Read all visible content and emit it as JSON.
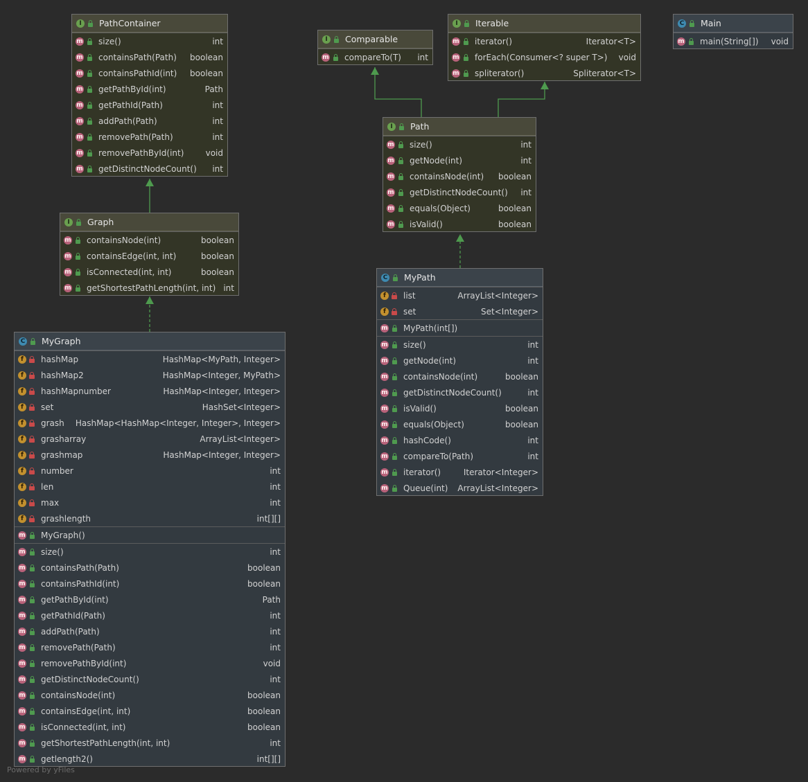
{
  "diagram": {
    "nodes": [
      {
        "id": "PathContainer",
        "kind": "interface",
        "name": "PathContainer",
        "sections": [
          [
            {
              "kind": "m",
              "vis": "public",
              "name": "size()",
              "type": "int"
            },
            {
              "kind": "m",
              "vis": "public",
              "name": "containsPath(Path)",
              "type": "boolean"
            },
            {
              "kind": "m",
              "vis": "public",
              "name": "containsPathId(int)",
              "type": "boolean"
            },
            {
              "kind": "m",
              "vis": "public",
              "name": "getPathById(int)",
              "type": "Path"
            },
            {
              "kind": "m",
              "vis": "public",
              "name": "getPathId(Path)",
              "type": "int"
            },
            {
              "kind": "m",
              "vis": "public",
              "name": "addPath(Path)",
              "type": "int"
            },
            {
              "kind": "m",
              "vis": "public",
              "name": "removePath(Path)",
              "type": "int"
            },
            {
              "kind": "m",
              "vis": "public",
              "name": "removePathById(int)",
              "type": "void"
            },
            {
              "kind": "m",
              "vis": "public",
              "name": "getDistinctNodeCount()",
              "type": "int"
            }
          ]
        ]
      },
      {
        "id": "Comparable",
        "kind": "interface",
        "name": "Comparable",
        "sections": [
          [
            {
              "kind": "m",
              "vis": "public",
              "name": "compareTo(T)",
              "type": "int"
            }
          ]
        ]
      },
      {
        "id": "Iterable",
        "kind": "interface",
        "name": "Iterable",
        "sections": [
          [
            {
              "kind": "m",
              "vis": "public",
              "name": "iterator()",
              "type": "Iterator<T>"
            },
            {
              "kind": "m",
              "vis": "public",
              "name": "forEach(Consumer<? super T>)",
              "type": "void"
            },
            {
              "kind": "m",
              "vis": "public",
              "name": "spliterator()",
              "type": "Spliterator<T>"
            }
          ]
        ]
      },
      {
        "id": "Main",
        "kind": "class",
        "name": "Main",
        "sections": [
          [
            {
              "kind": "m",
              "vis": "public",
              "name": "main(String[])",
              "type": "void"
            }
          ]
        ]
      },
      {
        "id": "Path",
        "kind": "interface",
        "name": "Path",
        "sections": [
          [
            {
              "kind": "m",
              "vis": "public",
              "name": "size()",
              "type": "int"
            },
            {
              "kind": "m",
              "vis": "public",
              "name": "getNode(int)",
              "type": "int"
            },
            {
              "kind": "m",
              "vis": "public",
              "name": "containsNode(int)",
              "type": "boolean"
            },
            {
              "kind": "m",
              "vis": "public",
              "name": "getDistinctNodeCount()",
              "type": "int"
            },
            {
              "kind": "m",
              "vis": "public",
              "name": "equals(Object)",
              "type": "boolean"
            },
            {
              "kind": "m",
              "vis": "public",
              "name": "isValid()",
              "type": "boolean"
            }
          ]
        ]
      },
      {
        "id": "Graph",
        "kind": "interface",
        "name": "Graph",
        "sections": [
          [
            {
              "kind": "m",
              "vis": "public",
              "name": "containsNode(int)",
              "type": "boolean"
            },
            {
              "kind": "m",
              "vis": "public",
              "name": "containsEdge(int, int)",
              "type": "boolean"
            },
            {
              "kind": "m",
              "vis": "public",
              "name": "isConnected(int, int)",
              "type": "boolean"
            },
            {
              "kind": "m",
              "vis": "public",
              "name": "getShortestPathLength(int, int)",
              "type": "int"
            }
          ]
        ]
      },
      {
        "id": "MyPath",
        "kind": "class",
        "name": "MyPath",
        "sections": [
          [
            {
              "kind": "f",
              "vis": "private",
              "name": "list",
              "type": "ArrayList<Integer>"
            },
            {
              "kind": "f",
              "vis": "private",
              "name": "set",
              "type": "Set<Integer>"
            }
          ],
          [
            {
              "kind": "m",
              "vis": "public",
              "name": "MyPath(int[])",
              "type": ""
            }
          ],
          [
            {
              "kind": "m",
              "vis": "public",
              "name": "size()",
              "type": "int"
            },
            {
              "kind": "m",
              "vis": "public",
              "name": "getNode(int)",
              "type": "int"
            },
            {
              "kind": "m",
              "vis": "public",
              "name": "containsNode(int)",
              "type": "boolean"
            },
            {
              "kind": "m",
              "vis": "public",
              "name": "getDistinctNodeCount()",
              "type": "int"
            },
            {
              "kind": "m",
              "vis": "public",
              "name": "isValid()",
              "type": "boolean"
            },
            {
              "kind": "m",
              "vis": "public",
              "name": "equals(Object)",
              "type": "boolean"
            },
            {
              "kind": "m",
              "vis": "public",
              "name": "hashCode()",
              "type": "int"
            },
            {
              "kind": "m",
              "vis": "public",
              "name": "compareTo(Path)",
              "type": "int"
            },
            {
              "kind": "m",
              "vis": "public",
              "name": "iterator()",
              "type": "Iterator<Integer>"
            },
            {
              "kind": "m",
              "vis": "public",
              "name": "Queue(int)",
              "type": "ArrayList<Integer>"
            }
          ]
        ]
      },
      {
        "id": "MyGraph",
        "kind": "class",
        "name": "MyGraph",
        "sections": [
          [
            {
              "kind": "f",
              "vis": "private",
              "name": "hashMap",
              "type": "HashMap<MyPath, Integer>"
            },
            {
              "kind": "f",
              "vis": "private",
              "name": "hashMap2",
              "type": "HashMap<Integer, MyPath>"
            },
            {
              "kind": "f",
              "vis": "private",
              "name": "hashMapnumber",
              "type": "HashMap<Integer, Integer>"
            },
            {
              "kind": "f",
              "vis": "private",
              "name": "set",
              "type": "HashSet<Integer>"
            },
            {
              "kind": "f",
              "vis": "private",
              "name": "grash",
              "type": "HashMap<HashMap<Integer, Integer>, Integer>"
            },
            {
              "kind": "f",
              "vis": "private",
              "name": "grasharray",
              "type": "ArrayList<Integer>"
            },
            {
              "kind": "f",
              "vis": "private",
              "name": "grashmap",
              "type": "HashMap<Integer, Integer>"
            },
            {
              "kind": "f",
              "vis": "private",
              "name": "number",
              "type": "int"
            },
            {
              "kind": "f",
              "vis": "private",
              "name": "len",
              "type": "int"
            },
            {
              "kind": "f",
              "vis": "private",
              "name": "max",
              "type": "int"
            },
            {
              "kind": "f",
              "vis": "private",
              "name": "grashlength",
              "type": "int[][]"
            }
          ],
          [
            {
              "kind": "m",
              "vis": "public",
              "name": "MyGraph()",
              "type": ""
            }
          ],
          [
            {
              "kind": "m",
              "vis": "public",
              "name": "size()",
              "type": "int"
            },
            {
              "kind": "m",
              "vis": "public",
              "name": "containsPath(Path)",
              "type": "boolean"
            },
            {
              "kind": "m",
              "vis": "public",
              "name": "containsPathId(int)",
              "type": "boolean"
            },
            {
              "kind": "m",
              "vis": "public",
              "name": "getPathById(int)",
              "type": "Path"
            },
            {
              "kind": "m",
              "vis": "public",
              "name": "getPathId(Path)",
              "type": "int"
            },
            {
              "kind": "m",
              "vis": "public",
              "name": "addPath(Path)",
              "type": "int"
            },
            {
              "kind": "m",
              "vis": "public",
              "name": "removePath(Path)",
              "type": "int"
            },
            {
              "kind": "m",
              "vis": "public",
              "name": "removePathById(int)",
              "type": "void"
            },
            {
              "kind": "m",
              "vis": "public",
              "name": "getDistinctNodeCount()",
              "type": "int"
            },
            {
              "kind": "m",
              "vis": "public",
              "name": "containsNode(int)",
              "type": "boolean"
            },
            {
              "kind": "m",
              "vis": "public",
              "name": "containsEdge(int, int)",
              "type": "boolean"
            },
            {
              "kind": "m",
              "vis": "public",
              "name": "isConnected(int, int)",
              "type": "boolean"
            },
            {
              "kind": "m",
              "vis": "public",
              "name": "getShortestPathLength(int, int)",
              "type": "int"
            },
            {
              "kind": "m",
              "vis": "public",
              "name": "getlength2()",
              "type": "int[][]"
            }
          ]
        ]
      }
    ],
    "edges": [
      {
        "from": "Graph",
        "to": "PathContainer",
        "style": "extends"
      },
      {
        "from": "MyGraph",
        "to": "Graph",
        "style": "implements"
      },
      {
        "from": "Path",
        "to": "Comparable",
        "style": "extends"
      },
      {
        "from": "Path",
        "to": "Iterable",
        "style": "extends"
      },
      {
        "from": "MyPath",
        "to": "Path",
        "style": "implements"
      }
    ],
    "colors": {
      "background": "#2b2b2b",
      "edge": "#4e9a4e",
      "interface_badge": "#6aa04f",
      "class_badge": "#3e8ab0",
      "method_badge": "#b8627a",
      "field_badge": "#c2902e"
    },
    "footer": "Powered by yFiles"
  }
}
